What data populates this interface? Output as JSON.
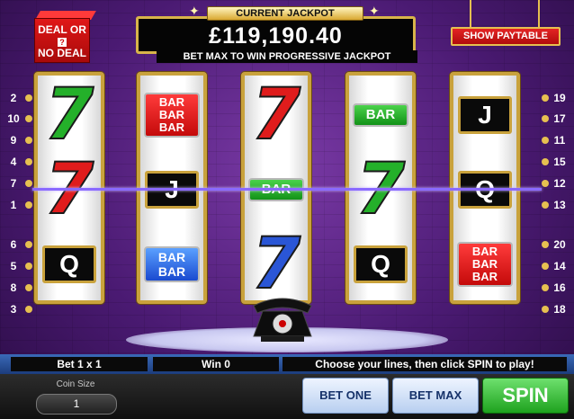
{
  "logo": {
    "line1": "DEAL OR",
    "mark": "?",
    "line2": "NO DEAL"
  },
  "jackpot": {
    "label": "CURRENT JACKPOT",
    "amount": "£119,190.40",
    "subtitle": "BET MAX TO WIN PROGRESSIVE JACKPOT"
  },
  "paytable_label": "SHOW PAYTABLE",
  "left_numbers": [
    "2",
    "10",
    "9",
    "4",
    "7",
    "1",
    "6",
    "5",
    "8",
    "3"
  ],
  "right_numbers": [
    "19",
    "17",
    "11",
    "15",
    "12",
    "13",
    "20",
    "14",
    "16",
    "18"
  ],
  "reels": [
    [
      {
        "type": "seven",
        "color": "green"
      },
      {
        "type": "seven",
        "color": "red"
      },
      {
        "type": "letter",
        "text": "Q"
      }
    ],
    [
      {
        "type": "bar",
        "lines": [
          "BAR",
          "BAR",
          "BAR"
        ],
        "color": "red"
      },
      {
        "type": "letter",
        "text": "J"
      },
      {
        "type": "bar",
        "lines": [
          "BAR",
          "BAR"
        ],
        "color": "blue"
      }
    ],
    [
      {
        "type": "seven",
        "color": "red"
      },
      {
        "type": "bar",
        "lines": [
          "BAR"
        ],
        "color": "green"
      },
      {
        "type": "seven",
        "color": "blue"
      }
    ],
    [
      {
        "type": "bar",
        "lines": [
          "BAR"
        ],
        "color": "green"
      },
      {
        "type": "seven",
        "color": "green"
      },
      {
        "type": "letter",
        "text": "Q"
      }
    ],
    [
      {
        "type": "letter",
        "text": "J"
      },
      {
        "type": "letter",
        "text": "Q"
      },
      {
        "type": "bar",
        "lines": [
          "BAR",
          "BAR",
          "BAR"
        ],
        "color": "red"
      }
    ]
  ],
  "status": {
    "bet": "Bet 1 x 1",
    "win": "Win 0",
    "message": "Choose your lines, then click SPIN to play!"
  },
  "coin": {
    "label": "Coin Size",
    "value": "1"
  },
  "buttons": {
    "bet_one": "BET ONE",
    "bet_max": "BET MAX",
    "spin": "SPIN"
  },
  "colors": {
    "gold": "#c9a23c",
    "spin_green": "#1ea21e",
    "payline": "#8a6aff"
  }
}
